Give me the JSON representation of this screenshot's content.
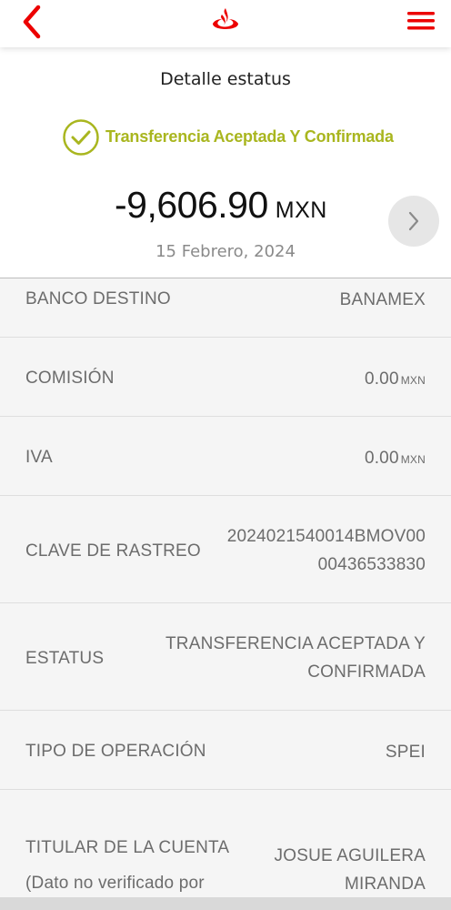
{
  "header": {
    "back_icon": "chevron-left-icon",
    "logo_icon": "santander-flame-icon",
    "menu_icon": "hamburger-menu-icon",
    "accent_color": "#ec0000"
  },
  "summary": {
    "title": "Detalle estatus",
    "status_text": "Transferencia Aceptada Y Confirmada",
    "status_color": "#a9b61f",
    "amount": "-9,606.90",
    "currency": "MXN",
    "date": "15 Febrero, 2024",
    "next_icon": "chevron-right-icon"
  },
  "details": {
    "banco_destino": {
      "label": "BANCO DESTINO",
      "value": "BANAMEX"
    },
    "comision": {
      "label": "COMISIÓN",
      "value": "0.00",
      "unit": "MXN"
    },
    "iva": {
      "label": "IVA",
      "value": "0.00",
      "unit": "MXN"
    },
    "clave_rastreo": {
      "label": "CLAVE DE RASTREO",
      "value_line1": "2024021540014BMOV00",
      "value_line2": "00436533830"
    },
    "estatus": {
      "label": "ESTATUS",
      "value_line1": "TRANSFERENCIA ACEPTADA Y",
      "value_line2": "CONFIRMADA"
    },
    "tipo_operacion": {
      "label": "TIPO DE OPERACIÓN",
      "value": "SPEI"
    },
    "titular": {
      "label_line1": "TITULAR DE LA CUENTA",
      "label_line2": "(Dato no verificado por",
      "value_line1": "JOSUE AGUILERA",
      "value_line2": "MIRANDA"
    }
  }
}
